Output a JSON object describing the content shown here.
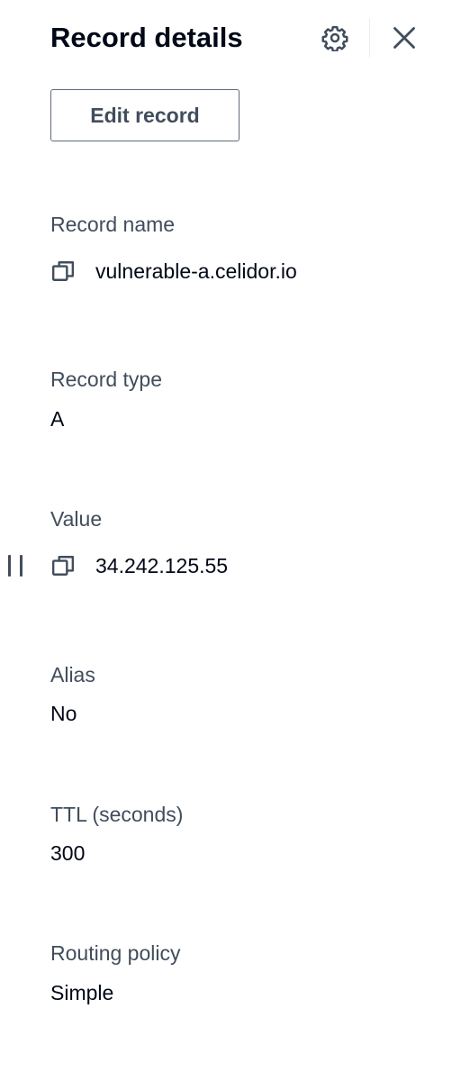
{
  "panel": {
    "title": "Record details",
    "settings_icon": "gear-icon",
    "close_icon": "close-icon",
    "edit_button_label": "Edit record"
  },
  "fields": {
    "record_name": {
      "label": "Record name",
      "value": "vulnerable-a.celidor.io",
      "icon": "copy-icon"
    },
    "record_type": {
      "label": "Record type",
      "value": "A"
    },
    "value": {
      "label": "Value",
      "value": "34.242.125.55",
      "icon": "copy-icon"
    },
    "alias": {
      "label": "Alias",
      "value": "No"
    },
    "ttl": {
      "label": "TTL (seconds)",
      "value": "300"
    },
    "routing_policy": {
      "label": "Routing policy",
      "value": "Simple"
    }
  },
  "colors": {
    "text_primary": "#000716",
    "text_secondary": "#414d5c",
    "button_border": "#5f6b7a"
  }
}
